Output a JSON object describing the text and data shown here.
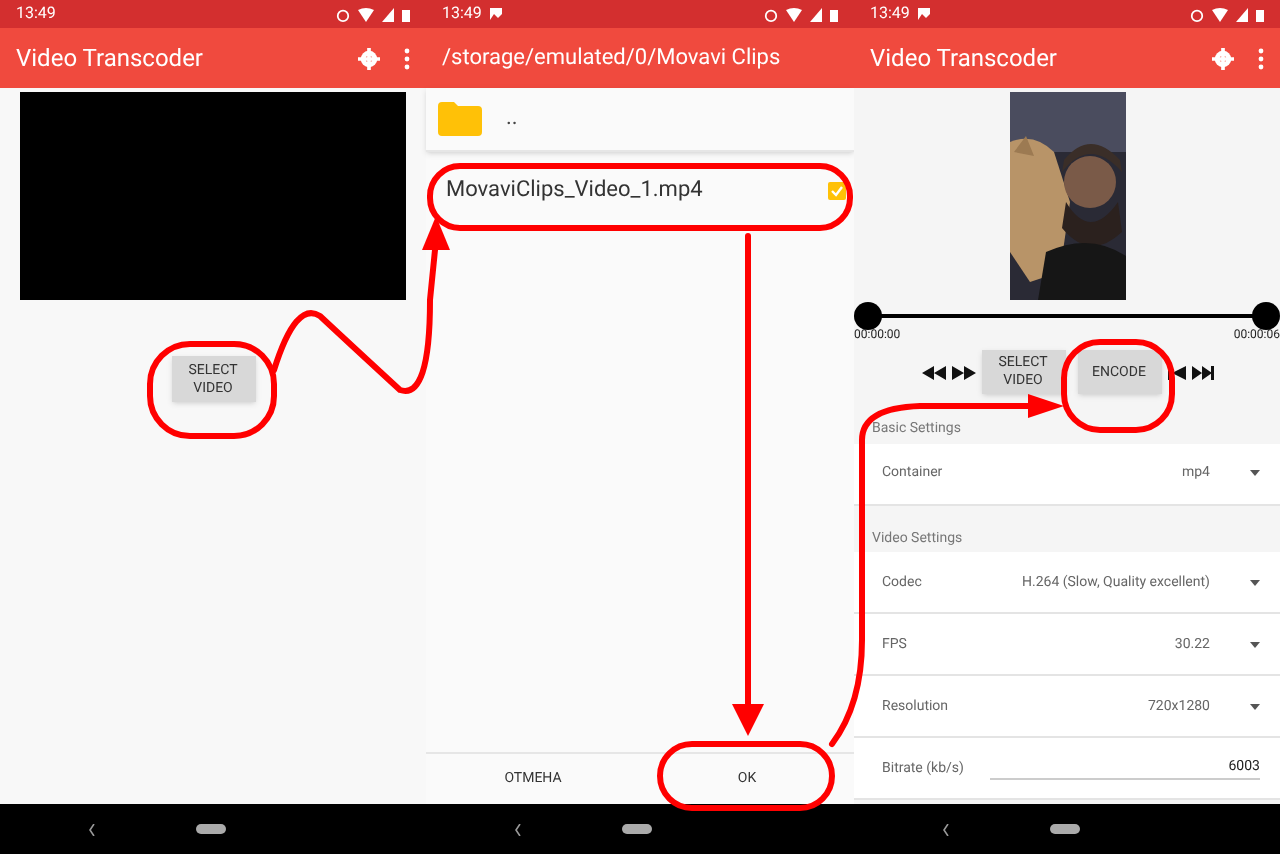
{
  "main_screen": {
    "status_time": "13:49",
    "title": "Video Transcoder",
    "select_button": "SELECT VIDEO"
  },
  "file_picker": {
    "status_time": "13:49",
    "path": "/storage/emulated/0/Movavi Clips",
    "items": [
      {
        "kind": "folder",
        "name": ".."
      },
      {
        "kind": "file",
        "name": "MovaviClips_Video_1.mp4",
        "checked": true
      }
    ],
    "buttons": [
      "ОТМЕНА",
      "OK"
    ]
  },
  "encoder_screen": {
    "status_time": "13:49",
    "title": "Video Transcoder",
    "trim_handles": [
      {
        "level": 0
      },
      {
        "level": 1
      }
    ],
    "start_time": "00:00:00",
    "end_time": "00:00:06",
    "select_button": "SELECT VIDEO",
    "encode_button": "ENCODE",
    "sections": [
      {
        "title": "Basic Settings",
        "rows": [
          {
            "kind": "dropdown",
            "label": "Container",
            "value": "mp4"
          }
        ]
      },
      {
        "title": "Video Settings",
        "rows": [
          {
            "kind": "dropdown",
            "label": "Codec",
            "value": "H.264 (Slow, Quality excellent)"
          },
          {
            "kind": "dropdown",
            "label": "FPS",
            "value": "30.22"
          },
          {
            "kind": "dropdown",
            "label": "Resolution",
            "value": "720x1280"
          },
          {
            "kind": "input",
            "label": "Bitrate (kb/s)",
            "value": "6003"
          }
        ]
      }
    ]
  }
}
